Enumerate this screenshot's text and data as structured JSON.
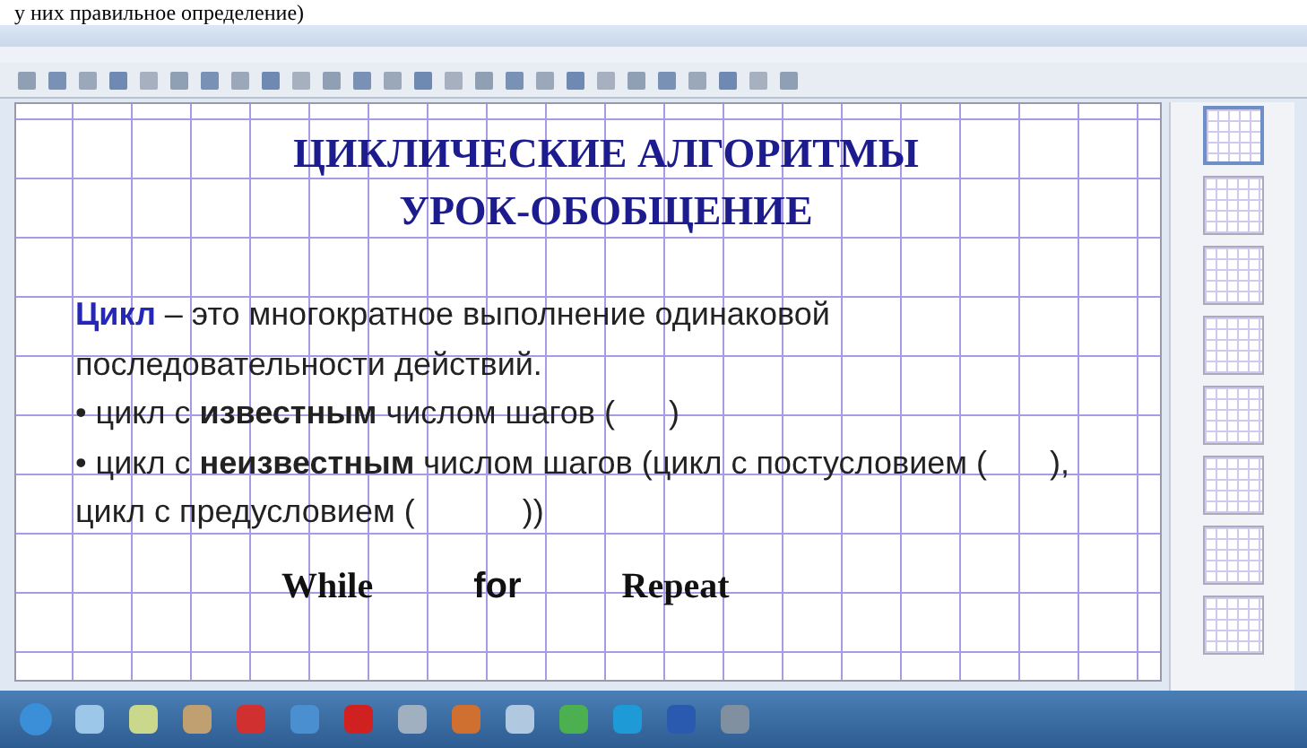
{
  "caption": "у них правильное определение)",
  "slide": {
    "title_lines": [
      "ЦИКЛИЧЕСКИЕ АЛГОРИТМЫ",
      "УРОК-ОБОБЩЕНИЕ"
    ],
    "paragraphs": [
      {
        "kind": "definition",
        "term": "Цикл",
        "text": " – это многократное выполнение одинаковой последовательности действий."
      },
      {
        "kind": "bullet",
        "text": "• цикл с **известным** числом шагов (      )"
      },
      {
        "kind": "bullet",
        "text": "• цикл с **неизвестным** числом шагов (цикл с постусловием (       ), цикл с предусловием (            ))"
      }
    ],
    "keywords": [
      "While",
      "for",
      "Repeat"
    ]
  },
  "thumbnails": [
    {
      "selected": true
    },
    {
      "selected": false
    },
    {
      "selected": false
    },
    {
      "selected": false
    },
    {
      "selected": false
    },
    {
      "selected": false
    },
    {
      "selected": false
    },
    {
      "selected": false
    }
  ]
}
